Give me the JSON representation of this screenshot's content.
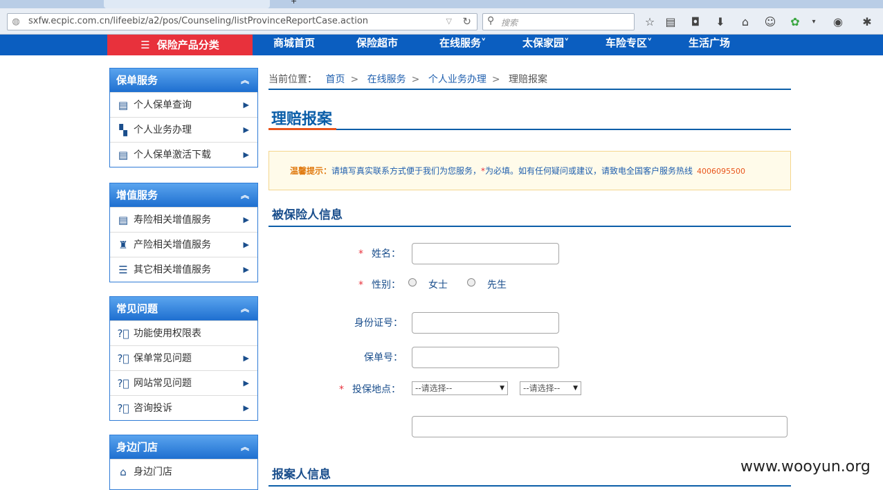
{
  "browser": {
    "tabs": [
      "",
      ""
    ],
    "url": "sxfw.ecpic.com.cn/lifeebiz/a2/pos/Counseling/listProvinceReportCase.action",
    "search_placeholder": "搜索"
  },
  "site_nav": {
    "category_button": "保险产品分类",
    "items": [
      "商城首页",
      "保险超市",
      "在线服务",
      "太保家园",
      "车险专区",
      "生活广场"
    ]
  },
  "sidebar": [
    {
      "title": "保单服务",
      "items": [
        {
          "label": "个人保单查询",
          "icon": "policy-search-icon"
        },
        {
          "label": "个人业务办理",
          "icon": "person-business-icon"
        },
        {
          "label": "个人保单激活下载",
          "icon": "policy-download-icon"
        }
      ]
    },
    {
      "title": "增值服务",
      "items": [
        {
          "label": "寿险相关增值服务",
          "icon": "life-service-icon"
        },
        {
          "label": "产险相关增值服务",
          "icon": "property-service-icon"
        },
        {
          "label": "其它相关增值服务",
          "icon": "other-service-icon"
        }
      ]
    },
    {
      "title": "常见问题",
      "items": [
        {
          "label": "功能使用权限表",
          "icon": "question-icon"
        },
        {
          "label": "保单常见问题",
          "icon": "question-icon"
        },
        {
          "label": "网站常见问题",
          "icon": "question-icon"
        },
        {
          "label": "咨询投诉",
          "icon": "question-icon"
        }
      ]
    },
    {
      "title": "身边门店",
      "items": [
        {
          "label": "身边门店",
          "icon": "home-icon"
        }
      ]
    }
  ],
  "breadcrumb": {
    "prefix": "当前位置：",
    "items": [
      "首页",
      "在线服务",
      "个人业务办理",
      "理赔报案"
    ]
  },
  "page_title": "理赔报案",
  "notice": {
    "label": "温馨提示：",
    "text_a": "请填写真实联系方式便于我们为您服务，",
    "required_mark": "*",
    "text_b": "为必填。如有任何疑问或建议，请致电全国客户服务热线",
    "phone": "4006095500"
  },
  "insured_section": {
    "title": "被保险人信息",
    "name_label": "姓名：",
    "gender_label": "性别：",
    "gender_options": [
      "女士",
      "先生"
    ],
    "id_label": "身份证号：",
    "policy_label": "保单号：",
    "location_label": "投保地点：",
    "select_province": "--请选择--",
    "select_city": "--请选择--"
  },
  "reporter_section": {
    "title": "报案人信息"
  },
  "watermark": "www.wooyun.org"
}
